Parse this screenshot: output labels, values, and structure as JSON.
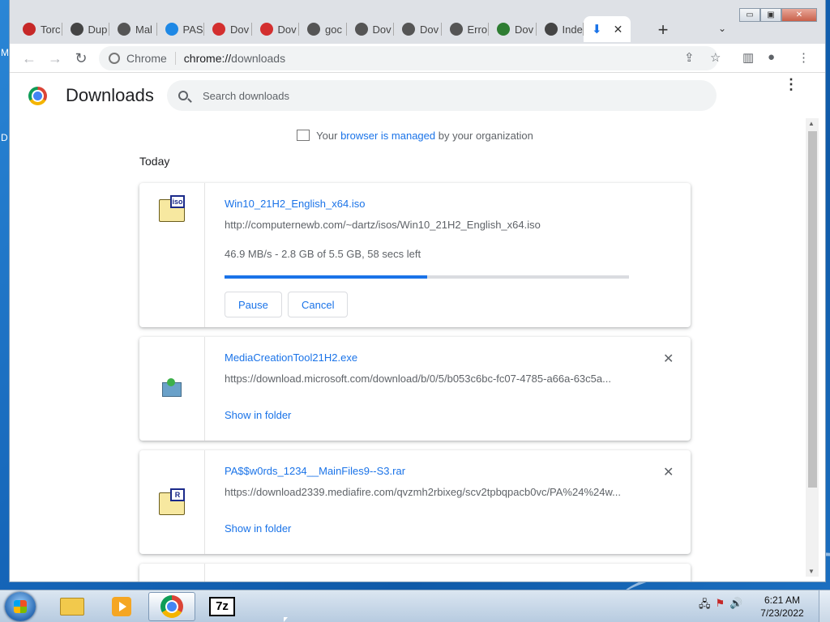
{
  "desktop": {
    "fragment_top": "M",
    "fragment_mid": "D"
  },
  "window": {
    "tabs": [
      {
        "label": "Torc",
        "color": "#c62828"
      },
      {
        "label": "Dup",
        "color": "#444444"
      },
      {
        "label": "Mal",
        "color": "#555555"
      },
      {
        "label": "PAS",
        "color": "#1e88e5"
      },
      {
        "label": "Dov",
        "color": "#d32f2f"
      },
      {
        "label": "Dov",
        "color": "#d32f2f"
      },
      {
        "label": "goc",
        "color": "#555555"
      },
      {
        "label": "Dov",
        "color": "#555555"
      },
      {
        "label": "Dov",
        "color": "#555555"
      },
      {
        "label": "Erro",
        "color": "#555555"
      },
      {
        "label": "Dov",
        "color": "#2e7d32"
      },
      {
        "label": "Inde",
        "color": "#444444"
      }
    ],
    "active_tab_icon": "download-icon",
    "controls": {
      "minimize": "▭",
      "maximize": "▣",
      "close": "✕"
    }
  },
  "toolbar": {
    "scheme": "Chrome",
    "url_host": "chrome://",
    "url_path": "downloads"
  },
  "page": {
    "title": "Downloads",
    "search_placeholder": "Search downloads",
    "managed_prefix": "Your ",
    "managed_link": "browser is managed",
    "managed_suffix": " by your organization",
    "section": "Today"
  },
  "downloads": [
    {
      "name": "Win10_21H2_English_x64.iso",
      "url": "http://computernewb.com/~dartz/isos/Win10_21H2_English_x64.iso",
      "status": "46.9 MB/s - 2.8 GB of 5.5 GB, 58 secs left",
      "progress": 0.5,
      "pause_label": "Pause",
      "cancel_label": "Cancel",
      "tag": "iso"
    },
    {
      "name": "MediaCreationTool21H2.exe",
      "url": "https://download.microsoft.com/download/b/0/5/b053c6bc-fc07-4785-a66a-63c5a...",
      "link": "Show in folder"
    },
    {
      "name": "PA$$w0rds_1234__MainFiles9--S3.rar",
      "url": "https://download2339.mediafire.com/qvzmh2rbixeg/scv2tpbqpacb0vc/PA%24%24w...",
      "link": "Show in folder",
      "tag": "R"
    }
  ],
  "taskbar": {
    "clock_time": "6:21 AM",
    "clock_date": "7/23/2022",
    "sevenz_label": "7z"
  }
}
